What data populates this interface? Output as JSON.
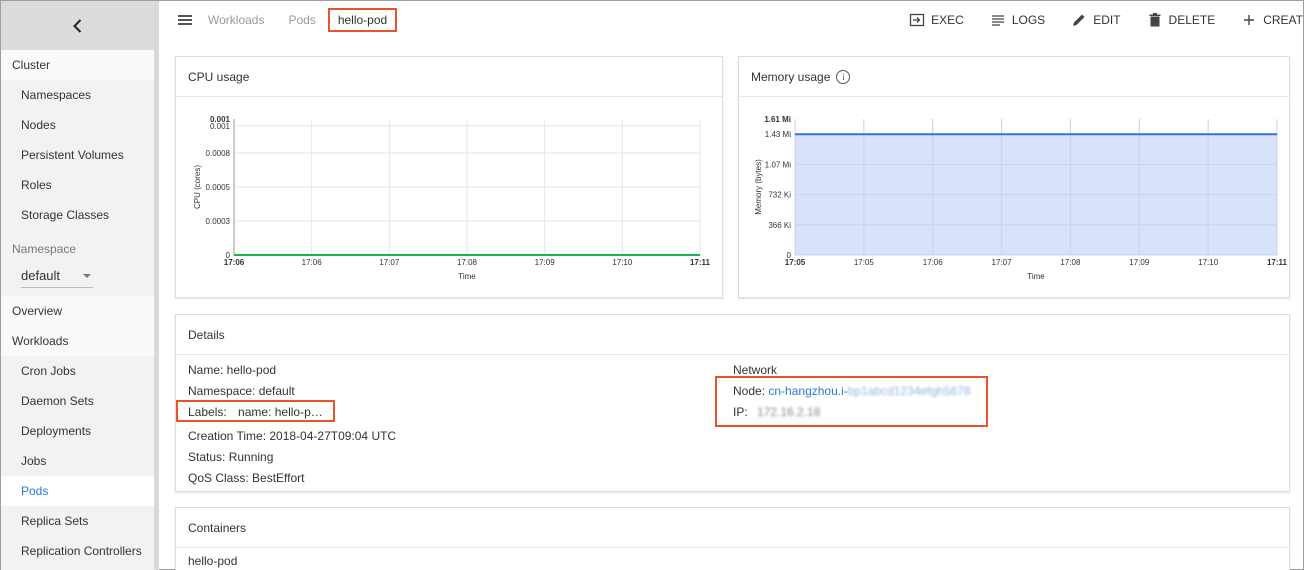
{
  "sidebar": {
    "items": [
      {
        "label": "Cluster",
        "type": "section"
      },
      {
        "label": "Namespaces",
        "type": "item"
      },
      {
        "label": "Nodes",
        "type": "item"
      },
      {
        "label": "Persistent Volumes",
        "type": "item"
      },
      {
        "label": "Roles",
        "type": "item"
      },
      {
        "label": "Storage Classes",
        "type": "item"
      }
    ],
    "namespace_label": "Namespace",
    "namespace_value": "default",
    "items2": [
      {
        "label": "Overview",
        "type": "section"
      },
      {
        "label": "Workloads",
        "type": "section"
      },
      {
        "label": "Cron Jobs",
        "type": "item"
      },
      {
        "label": "Daemon Sets",
        "type": "item"
      },
      {
        "label": "Deployments",
        "type": "item"
      },
      {
        "label": "Jobs",
        "type": "item"
      },
      {
        "label": "Pods",
        "type": "item",
        "active": true
      },
      {
        "label": "Replica Sets",
        "type": "item"
      },
      {
        "label": "Replication Controllers",
        "type": "item"
      }
    ]
  },
  "breadcrumb": {
    "items": [
      "Workloads",
      "Pods"
    ],
    "current": "hello-pod"
  },
  "actions": {
    "exec": "EXEC",
    "logs": "LOGS",
    "edit": "EDIT",
    "delete": "DELETE",
    "create": "CREAT"
  },
  "cpu": {
    "title": "CPU usage",
    "ylabel": "CPU (cores)",
    "xlabel": "Time",
    "yticks": [
      "0.001",
      "0.001",
      "0.0008",
      "0.0005",
      "0.0003",
      "0"
    ],
    "xticks": [
      "17:06",
      "17:06",
      "17:07",
      "17:08",
      "17:09",
      "17:10",
      "17:11"
    ]
  },
  "memory": {
    "title": "Memory usage",
    "ylabel": "Memory (bytes)",
    "xlabel": "Time",
    "yticks": [
      "1.61 Mi",
      "1.43 Mi",
      "1.07 Mi",
      "732 Ki",
      "366 Ki",
      "0"
    ],
    "xticks": [
      "17:05",
      "17:05",
      "17:06",
      "17:07",
      "17:08",
      "17:09",
      "17:10",
      "17:11"
    ]
  },
  "chart_data": [
    {
      "type": "line",
      "title": "CPU usage",
      "xlabel": "Time",
      "ylabel": "CPU (cores)",
      "x": [
        "17:06",
        "17:07",
        "17:08",
        "17:09",
        "17:10",
        "17:11"
      ],
      "series": [
        {
          "values": [
            0,
            0,
            0,
            0,
            0,
            0
          ]
        }
      ],
      "ylim": [
        0,
        0.001
      ],
      "grid": true,
      "color": "#1db34f"
    },
    {
      "type": "area",
      "title": "Memory usage",
      "xlabel": "Time",
      "ylabel": "Memory (bytes)",
      "x": [
        "17:05",
        "17:06",
        "17:07",
        "17:08",
        "17:09",
        "17:10",
        "17:11"
      ],
      "series": [
        {
          "values": [
            1.43,
            1.43,
            1.43,
            1.43,
            1.43,
            1.43,
            1.43
          ],
          "unit": "Mi"
        }
      ],
      "ylim": [
        0,
        1.61
      ],
      "grid": true,
      "color": "#326de6",
      "fill": "#d6e0f8"
    }
  ],
  "details": {
    "title": "Details",
    "name": "Name: hello-pod",
    "namespace": "Namespace: default",
    "labels_key": "Labels:",
    "labels_value": "name: hello-p…",
    "creation": "Creation Time: 2018-04-27T09:04 UTC",
    "status": "Status: Running",
    "qos": "QoS Class: BestEffort",
    "network_title": "Network",
    "node_key": "Node:",
    "node_value": "cn-hangzhou.i-",
    "node_blur": "bp1abcd1234efgh5678",
    "ip_key": "IP:",
    "ip_blur": "172.16.2.18"
  },
  "containers": {
    "title": "Containers",
    "first": "hello-pod"
  },
  "colors": {
    "accent": "#2979d9",
    "highlight": "#e8532b",
    "cpu_line": "#1db34f",
    "mem_line": "#326de6",
    "mem_fill": "#d6e0f8"
  }
}
